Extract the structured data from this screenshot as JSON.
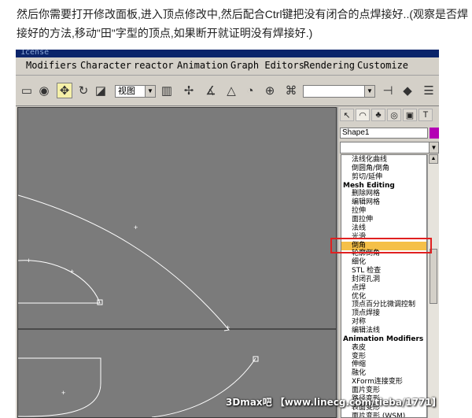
{
  "caption": "然后你需要打开修改面板,进入顶点修改中,然后配合Ctrl键把没有闭合的点焊接好..(观察是否焊接好的方法,移动\"田\"字型的顶点,如果断开就证明没有焊接好.)",
  "window": {
    "title": "1cense"
  },
  "menu": [
    "Modifiers",
    "Character",
    "reactor",
    "Animation",
    "Graph Editors",
    "Rendering",
    "Customize"
  ],
  "toolbar": {
    "view_combo": "视图",
    "icons": [
      "select-region-icon",
      "select-object-icon",
      "move-icon",
      "rotate-icon",
      "scale-icon",
      "view-combo",
      "pivot-icon",
      "snap-icon",
      "angle-snap-icon",
      "percent-snap-icon",
      "spinner-snap-icon",
      "named-selection-icon",
      "mirror-icon",
      "align-icon"
    ]
  },
  "command_panel": {
    "tabs": [
      "create-icon",
      "modify-icon",
      "hierarchy-icon",
      "motion-icon",
      "display-icon",
      "utilities-icon"
    ],
    "object_name": "Shape1",
    "object_color": "#b400b4",
    "modifier_list": [
      {
        "label": "法线化曲线",
        "type": "item"
      },
      {
        "label": "倒圆角/倒角",
        "type": "item"
      },
      {
        "label": "剪切/延伸",
        "type": "item"
      },
      {
        "label": "Mesh Editing",
        "type": "header"
      },
      {
        "label": "删除网格",
        "type": "item"
      },
      {
        "label": "编辑网格",
        "type": "item"
      },
      {
        "label": "拉伸",
        "type": "item"
      },
      {
        "label": "面拉伸",
        "type": "item"
      },
      {
        "label": "法线",
        "type": "item"
      },
      {
        "label": "光滑",
        "type": "item"
      },
      {
        "label": "倒角",
        "type": "item",
        "selected": true
      },
      {
        "label": "轮廓倒角",
        "type": "item"
      },
      {
        "label": "细化",
        "type": "item"
      },
      {
        "label": "STL 检查",
        "type": "item"
      },
      {
        "label": "封闭孔洞",
        "type": "item"
      },
      {
        "label": "点焊",
        "type": "item"
      },
      {
        "label": "优化",
        "type": "item"
      },
      {
        "label": "顶点百分比微调控制",
        "type": "item"
      },
      {
        "label": "顶点焊接",
        "type": "item"
      },
      {
        "label": "对称",
        "type": "item"
      },
      {
        "label": "编辑法线",
        "type": "item"
      },
      {
        "label": "Animation Modifiers",
        "type": "header"
      },
      {
        "label": "表皮",
        "type": "item"
      },
      {
        "label": "变形",
        "type": "item"
      },
      {
        "label": "伸缩",
        "type": "item"
      },
      {
        "label": "融化",
        "type": "item"
      },
      {
        "label": "XForm连接变形",
        "type": "item"
      },
      {
        "label": "面片变形",
        "type": "item"
      },
      {
        "label": "路径变形",
        "type": "item"
      },
      {
        "label": "表面变形",
        "type": "item"
      },
      {
        "label": "面片变形 (WSM)",
        "type": "item"
      }
    ]
  },
  "watermark": "3Dmax吧 【www.linecg.com/tieba/1771】",
  "colors": {
    "highlight_border": "#e02020",
    "selected_row": "#f5c048",
    "viewport_bg": "#7b7b7b"
  }
}
